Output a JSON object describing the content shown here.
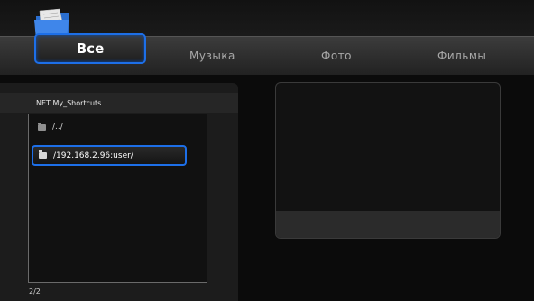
{
  "tabs": {
    "all": "Все",
    "music": "Музыка",
    "photo": "Фото",
    "movies": "Фильмы"
  },
  "browser": {
    "path": "NET My_Shortcuts",
    "items": [
      {
        "label": "/../"
      },
      {
        "label": "/192.168.2.96:user/"
      }
    ],
    "pager": "2/2"
  }
}
